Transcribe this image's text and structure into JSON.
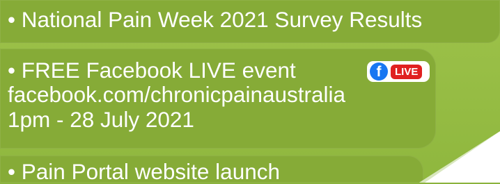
{
  "items": [
    {
      "text": "• National Pain Week 2021 Survey Results"
    },
    {
      "text": "• FREE Facebook LIVE event",
      "badge": {
        "icon": "facebook-icon",
        "glyph": "f",
        "label": "LIVE"
      },
      "link": "facebook.com/chronicpainaustralia",
      "datetime": "1pm - 28 July 2021"
    },
    {
      "text": "• Pain Portal website launch"
    }
  ],
  "colors": {
    "background": "#8fb73e",
    "card": "#86ab37",
    "text": "#ffffff",
    "facebook_blue": "#1877f2",
    "live_red": "#e02020"
  }
}
